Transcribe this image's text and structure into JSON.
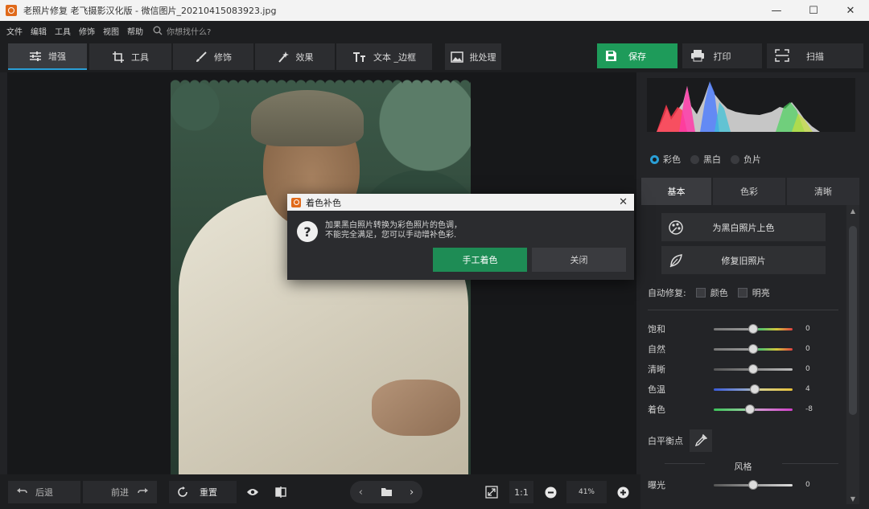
{
  "window": {
    "title": "老照片修复 老飞摄影汉化版 - 微信图片_20210415083923.jpg",
    "controls": [
      "—",
      "☐",
      "✕"
    ]
  },
  "menu": {
    "items": [
      "文件",
      "编辑",
      "工具",
      "修饰",
      "视图",
      "帮助"
    ],
    "search_placeholder": "你想找什么?"
  },
  "toolbar": {
    "tabs": [
      {
        "label": "增强",
        "icon": "sliders-icon"
      },
      {
        "label": "工具",
        "icon": "crop-icon"
      },
      {
        "label": "修饰",
        "icon": "brush-icon"
      },
      {
        "label": "效果",
        "icon": "magic-wand-icon"
      },
      {
        "label": "文本 _边框",
        "icon": "text-icon"
      }
    ],
    "batch_label": "批处理",
    "save_label": "保存",
    "print_label": "打印",
    "scan_label": "扫描"
  },
  "bottom": {
    "undo_label": "后退",
    "redo_label": "前进",
    "reset_label": "重置",
    "ratio_label": "1:1",
    "zoom_value": "41%"
  },
  "panel": {
    "modes": [
      {
        "label": "彩色",
        "selected": true
      },
      {
        "label": "黑白",
        "selected": false
      },
      {
        "label": "负片",
        "selected": false
      }
    ],
    "tabs": [
      "基本",
      "色彩",
      "清晰"
    ],
    "colorize_label": "为黑白照片上色",
    "restore_label": "修复旧照片",
    "auto_fix_label": "自动修复:",
    "auto_color_label": "颜色",
    "auto_bright_label": "明亮",
    "sliders": [
      {
        "label": "饱和",
        "value": "0",
        "level": 0.5
      },
      {
        "label": "自然",
        "value": "0",
        "level": 0.5
      },
      {
        "label": "清晰",
        "value": "0",
        "level": 0.5
      },
      {
        "label": "色温",
        "value": "4",
        "level": 0.52
      },
      {
        "label": "着色",
        "value": "-8",
        "level": 0.46
      }
    ],
    "white_balance_label": "白平衡点",
    "style_title": "风格",
    "exposure": {
      "label": "曝光",
      "value": "0",
      "level": 0.5
    }
  },
  "dialog": {
    "title": "着色补色",
    "line1": "加果黑白照片转换为彩色照片的色调，",
    "line2": "不能完全满足，您可以手动增补色彩.",
    "manual_label": "手工着色",
    "close_label": "关闭"
  },
  "colors": {
    "accent_blue": "#2a9fd6",
    "save_green": "#1e9b5a",
    "dialog_green": "#1e8c55"
  }
}
